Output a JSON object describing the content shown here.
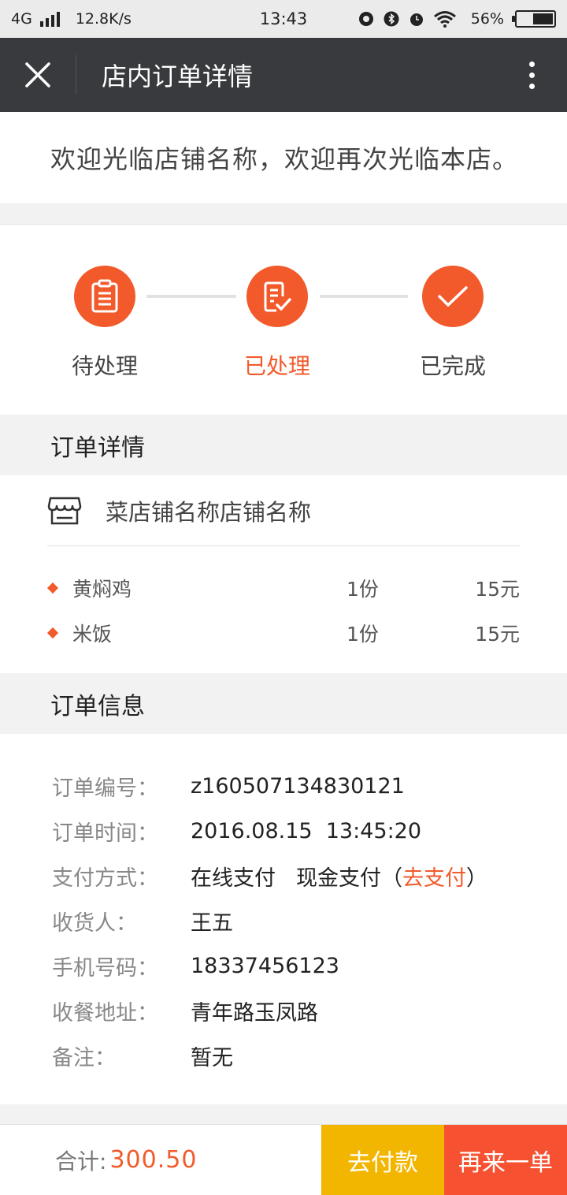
{
  "status_bar": {
    "network": "4G",
    "speed": "12.8K/s",
    "time": "13:43",
    "battery": "56%",
    "battery_level": 0.56
  },
  "nav": {
    "title": "店内订单详情"
  },
  "welcome": "欢迎光临店铺名称，欢迎再次光临本店。",
  "progress": {
    "steps": [
      {
        "label": "待处理",
        "icon": "clipboard-icon",
        "active": false
      },
      {
        "label": "已处理",
        "icon": "edit-check-icon",
        "active": true
      },
      {
        "label": "已完成",
        "icon": "checkmark-icon",
        "active": false
      }
    ]
  },
  "details": {
    "heading": "订单详情",
    "shop_name": "菜店铺名称店铺名称",
    "items": [
      {
        "name": "黄焖鸡",
        "qty": "1份",
        "price": "15元"
      },
      {
        "name": "米饭",
        "qty": "1份",
        "price": "15元"
      }
    ]
  },
  "info": {
    "heading": "订单信息",
    "order_no_label": "订单编号：",
    "order_no": "z160507134830121",
    "order_time_label": "订单时间：",
    "order_time": "2016.08.15  13:45:20",
    "payment_label": "支付方式：",
    "payment_online": "在线支付",
    "payment_cash": "现金支付",
    "paren_open": "（",
    "pay_link": "去支付",
    "paren_close": "）",
    "receiver_label": "收货人：",
    "receiver": "王五",
    "phone_label": "手机号码：",
    "phone": "18337456123",
    "address_label": "收餐地址：",
    "address": "青年路玉凤路",
    "note_label": "备注：",
    "note": "暂无"
  },
  "footer": {
    "total_label": "合计:",
    "total_amount": "300.50",
    "pay_button": "去付款",
    "reorder_button": "再来一单"
  },
  "colors": {
    "accent": "#f25a2b",
    "pay_button": "#f3b600",
    "reorder_button": "#f65232",
    "nav_bg": "#393a3e"
  }
}
